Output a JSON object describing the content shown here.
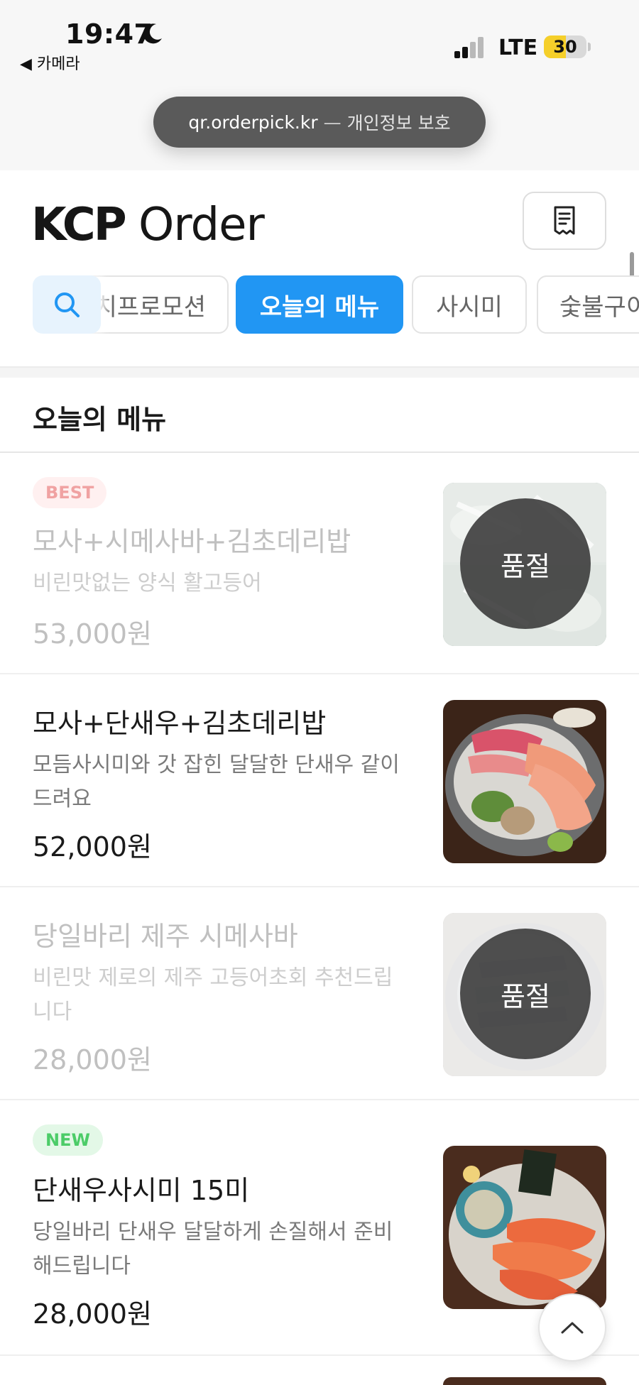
{
  "status_bar": {
    "time": "19:47",
    "back_app": "◀ 카메라",
    "network": "LTE",
    "battery": "30"
  },
  "browser": {
    "url": "qr.orderpick.kr",
    "separator": "—",
    "privacy": "개인정보 보호"
  },
  "header": {
    "logo_brand": "KCP",
    "logo_word": "Order"
  },
  "tabs": [
    {
      "label": "런치프로모션"
    },
    {
      "label": "오늘의 메뉴",
      "active": true
    },
    {
      "label": "사시미"
    },
    {
      "label": "숯불구이"
    }
  ],
  "section": {
    "title": "오늘의 메뉴"
  },
  "items": [
    {
      "badge": "BEST",
      "name": "모사+시메사바+김초데리밥",
      "desc": "비린맛없는 양식 활고등어",
      "price": "53,000원",
      "sold_out": true,
      "sold_out_label": "품절"
    },
    {
      "name": "모사+단새우+김초데리밥",
      "desc": "모듬사시미와 갓 잡힌 달달한 단새우 같이 드려요",
      "price": "52,000원",
      "sold_out": false
    },
    {
      "name": "당일바리 제주 시메사바",
      "desc": "비린맛 제로의 제주 고등어초회 추천드립니다",
      "price": "28,000원",
      "sold_out": true,
      "sold_out_label": "품절"
    },
    {
      "badge": "NEW",
      "name": "단새우사시미 15미",
      "desc": "당일바리 단새우 달달하게 손질해서 준비해드립니다",
      "price": "28,000원",
      "sold_out": false
    }
  ],
  "icons": {
    "search": "search-icon",
    "receipt": "receipt-icon",
    "scroll_top": "chevron-up-icon",
    "moon": "moon-icon"
  },
  "colors": {
    "accent": "#2196f3",
    "best_badge": "#f0a2a2",
    "new_badge": "#4ccc68",
    "battery": "#f5cf2a"
  }
}
